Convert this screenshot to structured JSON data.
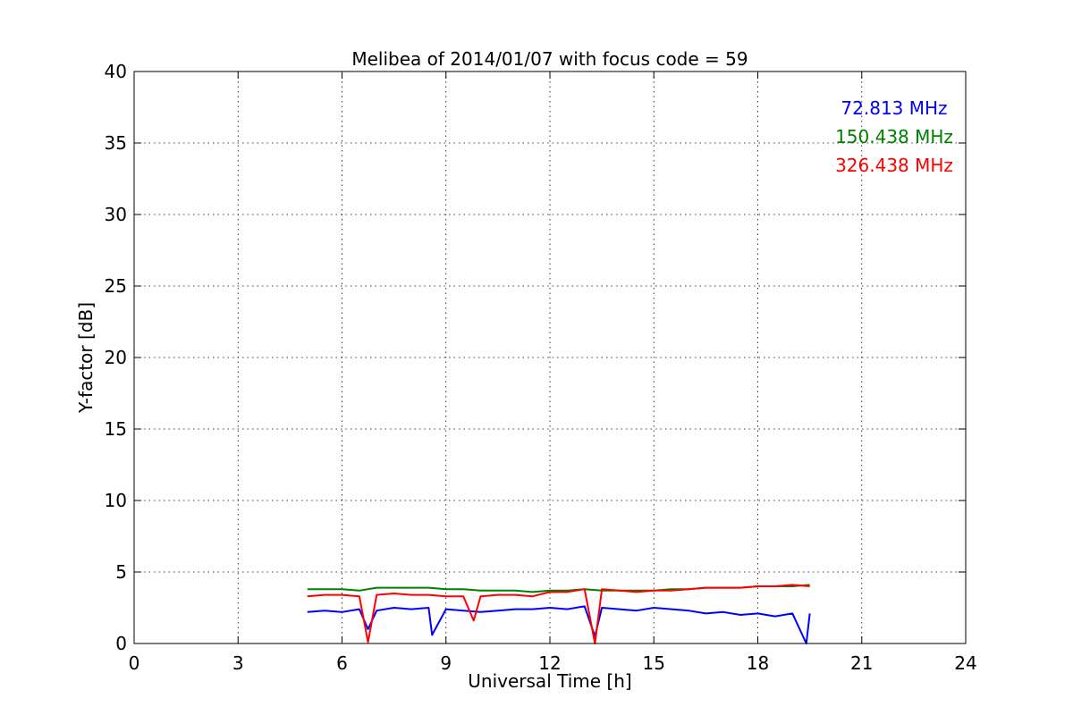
{
  "chart_data": {
    "type": "line",
    "title": "Melibea of 2014/01/07 with focus code = 59",
    "xlabel": "Universal Time [h]",
    "ylabel": "Y-factor [dB]",
    "xlim": [
      0,
      24
    ],
    "ylim": [
      0,
      40
    ],
    "xticks": [
      0,
      3,
      6,
      9,
      12,
      15,
      18,
      21,
      24
    ],
    "yticks": [
      0,
      5,
      10,
      15,
      20,
      25,
      30,
      35,
      40
    ],
    "grid": true,
    "legend_position": "top-right",
    "series": [
      {
        "name": "72.813 MHz",
        "color": "#0000ff",
        "x": [
          5.0,
          5.5,
          6.0,
          6.5,
          6.75,
          7.0,
          7.5,
          8.0,
          8.5,
          8.6,
          9.0,
          9.5,
          10.0,
          10.5,
          11.0,
          11.5,
          12.0,
          12.5,
          13.0,
          13.3,
          13.5,
          14.0,
          14.5,
          15.0,
          15.5,
          16.0,
          16.5,
          17.0,
          17.5,
          18.0,
          18.5,
          19.0,
          19.4,
          19.5
        ],
        "y": [
          2.2,
          2.3,
          2.2,
          2.4,
          1.0,
          2.3,
          2.5,
          2.4,
          2.5,
          0.6,
          2.4,
          2.3,
          2.2,
          2.3,
          2.4,
          2.4,
          2.5,
          2.4,
          2.6,
          0.5,
          2.5,
          2.4,
          2.3,
          2.5,
          2.4,
          2.3,
          2.1,
          2.2,
          2.0,
          2.1,
          1.9,
          2.1,
          0.0,
          2.1
        ]
      },
      {
        "name": "150.438 MHz",
        "color": "#008000",
        "x": [
          5.0,
          5.5,
          6.0,
          6.5,
          7.0,
          7.5,
          8.0,
          8.5,
          9.0,
          9.5,
          10.0,
          10.5,
          11.0,
          11.5,
          12.0,
          12.5,
          13.0,
          13.5,
          14.0,
          14.5,
          15.0,
          15.5,
          16.0,
          16.5,
          17.0,
          17.5,
          18.0,
          18.5,
          19.0,
          19.5
        ],
        "y": [
          3.8,
          3.8,
          3.8,
          3.7,
          3.9,
          3.9,
          3.9,
          3.9,
          3.8,
          3.8,
          3.7,
          3.7,
          3.7,
          3.6,
          3.7,
          3.7,
          3.8,
          3.7,
          3.7,
          3.7,
          3.7,
          3.8,
          3.8,
          3.9,
          3.9,
          3.9,
          4.0,
          4.0,
          4.0,
          4.1
        ]
      },
      {
        "name": "326.438 MHz",
        "color": "#ff0000",
        "x": [
          5.0,
          5.5,
          6.0,
          6.5,
          6.75,
          7.0,
          7.5,
          8.0,
          8.5,
          9.0,
          9.5,
          9.8,
          10.0,
          10.5,
          11.0,
          11.5,
          12.0,
          12.5,
          13.0,
          13.3,
          13.5,
          14.0,
          14.5,
          15.0,
          15.5,
          16.0,
          16.5,
          17.0,
          17.5,
          18.0,
          18.5,
          19.0,
          19.5
        ],
        "y": [
          3.3,
          3.4,
          3.4,
          3.3,
          0.1,
          3.4,
          3.5,
          3.4,
          3.4,
          3.3,
          3.3,
          1.6,
          3.3,
          3.4,
          3.4,
          3.3,
          3.6,
          3.6,
          3.8,
          0.0,
          3.8,
          3.7,
          3.6,
          3.7,
          3.7,
          3.8,
          3.9,
          3.9,
          3.9,
          4.0,
          4.0,
          4.1,
          4.0
        ]
      }
    ]
  }
}
